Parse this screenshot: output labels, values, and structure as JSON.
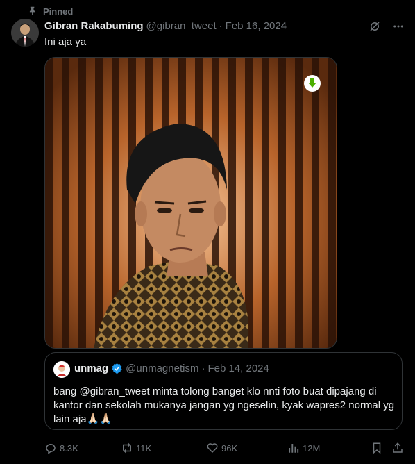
{
  "pinned_label": "Pinned",
  "author": {
    "name": "Gibran Rakabuming",
    "handle": "@gibran_tweet",
    "date": "Feb 16, 2024"
  },
  "tweet_text": "Ini aja ya",
  "quote": {
    "name": "unmag",
    "handle": "@unmagnetism",
    "date": "Feb 14, 2024",
    "text": "bang @gibran_tweet minta tolong banget klo nnti foto buat dipajang di kantor dan sekolah mukanya jangan yg ngeselin, kyak wapres2 normal yg lain aja🙏🏻🙏🏻"
  },
  "actions": {
    "replies": "8.3K",
    "reposts": "11K",
    "likes": "96K",
    "views": "12M"
  },
  "icons": [
    "pin-icon",
    "grok-icon",
    "more-icon",
    "download-icon",
    "verified-badge-icon",
    "reply-icon",
    "repost-icon",
    "like-icon",
    "views-icon",
    "bookmark-icon",
    "share-icon"
  ],
  "colors": {
    "background": "#000000",
    "text": "#e7e9ea",
    "muted": "#71767b",
    "verified": "#1d9bf0",
    "download": "#4caf00"
  }
}
